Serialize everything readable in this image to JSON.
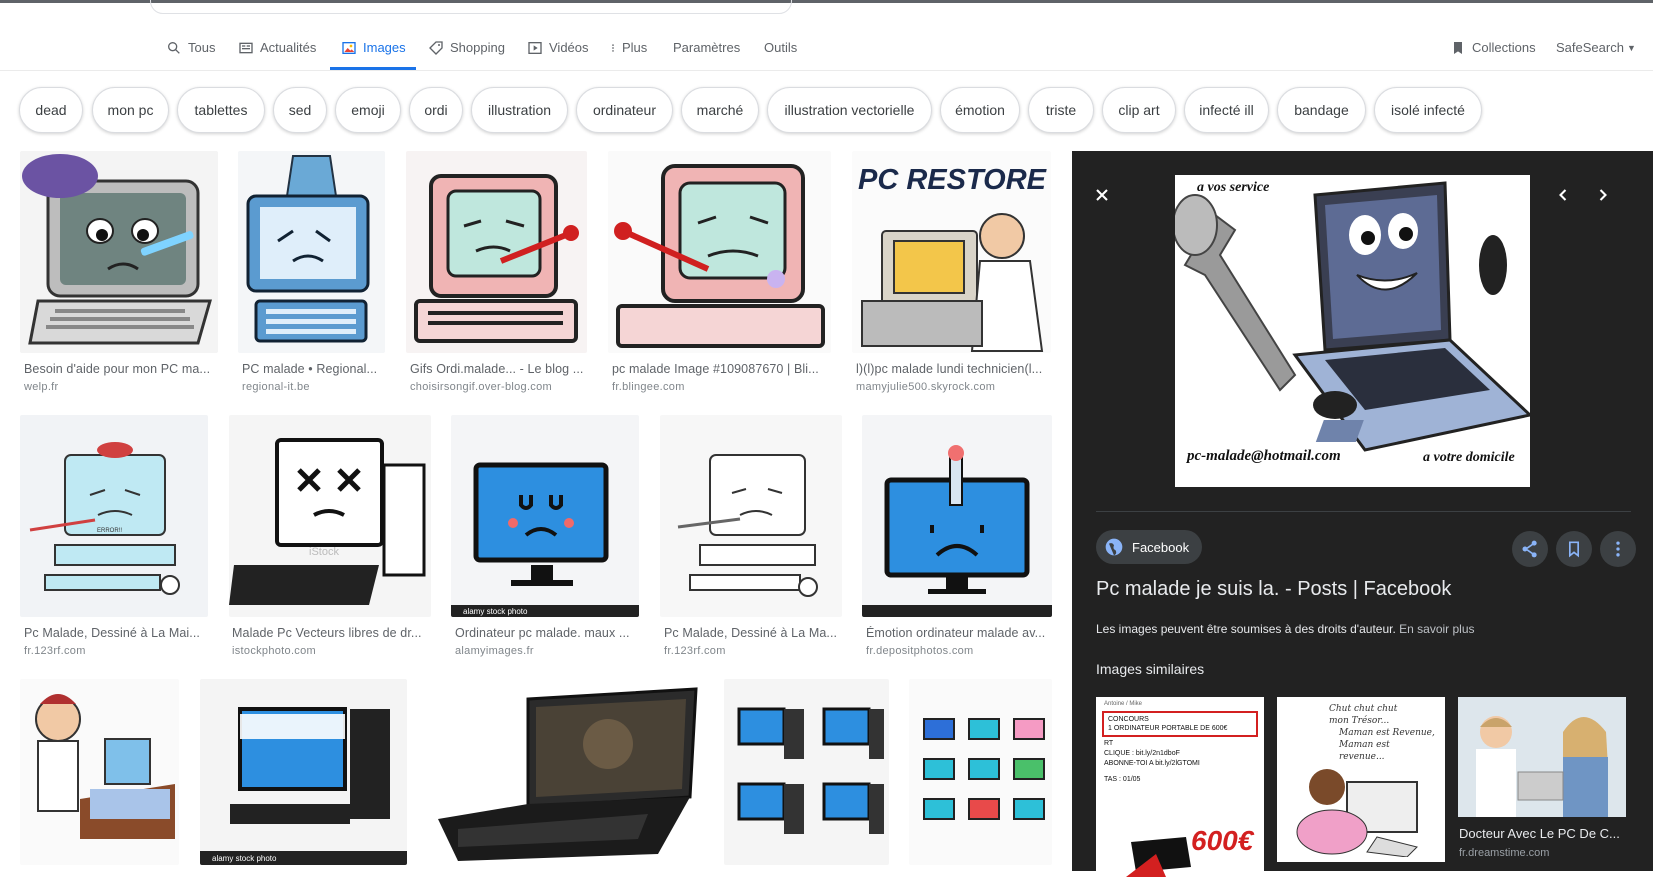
{
  "tabs": [
    {
      "label": "Tous",
      "icon": "search-icon"
    },
    {
      "label": "Actualités",
      "icon": "news-icon"
    },
    {
      "label": "Images",
      "icon": "image-icon",
      "active": true
    },
    {
      "label": "Shopping",
      "icon": "tag-icon"
    },
    {
      "label": "Vidéos",
      "icon": "play-icon"
    },
    {
      "label": "Plus",
      "icon": "more-vert-icon"
    },
    {
      "label": "Paramètres"
    },
    {
      "label": "Outils"
    }
  ],
  "header_right": {
    "collections": "Collections",
    "safesearch": "SafeSearch"
  },
  "chips": [
    "dead",
    "mon pc",
    "tablettes",
    "sed",
    "emoji",
    "ordi",
    "illustration",
    "ordinateur",
    "marché",
    "illustration vectorielle",
    "émotion",
    "triste",
    "clip art",
    "infecté ill",
    "bandage",
    "isolé infecté"
  ],
  "results_row1": [
    {
      "caption": "Besoin d'aide pour mon PC ma...",
      "domain": "welp.fr"
    },
    {
      "caption": "PC malade • Regional...",
      "domain": "regional-it.be"
    },
    {
      "caption": "Gifs Ordi.malade... - Le blog ...",
      "domain": "choisirsongif.over-blog.com"
    },
    {
      "caption": "pc malade Image #109087670 | Bli...",
      "domain": "fr.blingee.com"
    },
    {
      "caption": "l)(l)pc malade lundi technicien(l...",
      "domain": "mamyjulie500.skyrock.com"
    }
  ],
  "results_row2": [
    {
      "caption": "Pc Malade, Dessiné à La Mai...",
      "domain": "fr.123rf.com"
    },
    {
      "caption": "Malade Pc Vecteurs libres de dr...",
      "domain": "istockphoto.com"
    },
    {
      "caption": "Ordinateur pc malade. maux ...",
      "domain": "alamyimages.fr"
    },
    {
      "caption": "Pc Malade, Dessiné à La Ma...",
      "domain": "fr.123rf.com"
    },
    {
      "caption": "Émotion ordinateur malade av...",
      "domain": "fr.depositphotos.com"
    }
  ],
  "thumb_texts": {
    "pc_restore": "PC RESTORE",
    "erroril": "ERROR!!",
    "alamy": "alamy stock photo",
    "istock": "iStock"
  },
  "panel": {
    "preview_text_top": "a vos service",
    "preview_email": "pc-malade@hotmail.com",
    "preview_text_bottom": "a votre domicile",
    "source": "Facebook",
    "title": "Pc malade je suis la. - Posts | Facebook",
    "rights": "Les images peuvent être soumises à des droits d'auteur.",
    "learn_more": "En savoir plus",
    "similar_heading": "Images similaires",
    "similar": [
      {
        "lines": [
          "Antoine / Mike",
          "CONCOURS",
          "1 ORDINATEUR PORTABLE DE 600€",
          "RT",
          "CLIQUE : bit.ly/2n1dboF",
          "ABONNE-TOI A bit.ly/2lGTOMI",
          "TAS : 01/05"
        ],
        "price": "600€"
      },
      {
        "lines": [
          "Chut chut chut",
          "mon Trésor...",
          "Maman est Revenue,",
          "Maman est revenue..."
        ]
      },
      {
        "caption": "Docteur Avec Le PC De C...",
        "domain": "fr.dreamstime.com"
      }
    ]
  },
  "colors": {
    "accent": "#1a73e8",
    "panel_bg": "#222222",
    "screen_blue": "#2d8fe0"
  }
}
